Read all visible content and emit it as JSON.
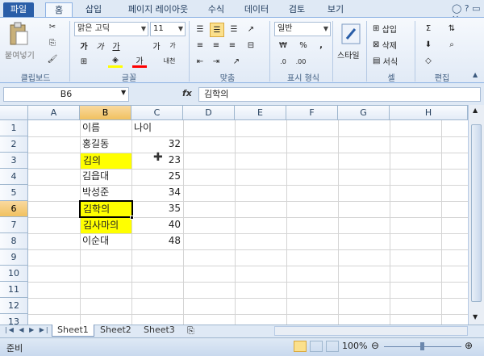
{
  "ribbon_tabs": [
    "파일",
    "홈",
    "삽입",
    "페이지 레이아웃",
    "수식",
    "데이터",
    "검토",
    "보기"
  ],
  "clipboard": {
    "paste_label": "붙여넣기",
    "group_label": "클립보드"
  },
  "font": {
    "name": "맑은 고딕",
    "size": "11",
    "bold": "가",
    "italic": "가",
    "underline": "가",
    "grow": "가",
    "shrink": "가",
    "phonetic": "내천",
    "group_label": "글꼴"
  },
  "alignment": {
    "group_label": "맞춤"
  },
  "number": {
    "format": "일반",
    "percent": "%",
    "comma": ",",
    "group_label": "표시 형식"
  },
  "styles": {
    "label": "스타일"
  },
  "cells": {
    "insert": "삽입",
    "delete": "삭제",
    "format": "서식",
    "group_label": "셀"
  },
  "editing": {
    "group_label": "편집"
  },
  "formula_bar": {
    "name_box": "B6",
    "fx": "fx",
    "value": "김학의"
  },
  "columns": [
    "A",
    "B",
    "C",
    "D",
    "E",
    "F",
    "G",
    "H"
  ],
  "rows": [
    "1",
    "2",
    "3",
    "4",
    "5",
    "6",
    "7",
    "8",
    "9",
    "10",
    "11",
    "12",
    "13"
  ],
  "table": {
    "headers": [
      "이름",
      "나이"
    ],
    "data": [
      {
        "name": "홍길동",
        "age": "32"
      },
      {
        "name": "김의",
        "age": "23"
      },
      {
        "name": "김읍대",
        "age": "25"
      },
      {
        "name": "박성준",
        "age": "34"
      },
      {
        "name": "김학의",
        "age": "35"
      },
      {
        "name": "김사마의",
        "age": "40"
      },
      {
        "name": "이순대",
        "age": "48"
      }
    ]
  },
  "sheets": [
    "Sheet1",
    "Sheet2",
    "Sheet3"
  ],
  "status": {
    "ready": "준비",
    "zoom": "100%"
  },
  "colors": {
    "highlight": "#ffff00",
    "selected_header": "#f1c15f",
    "file_tab": "#2a5ea8"
  }
}
